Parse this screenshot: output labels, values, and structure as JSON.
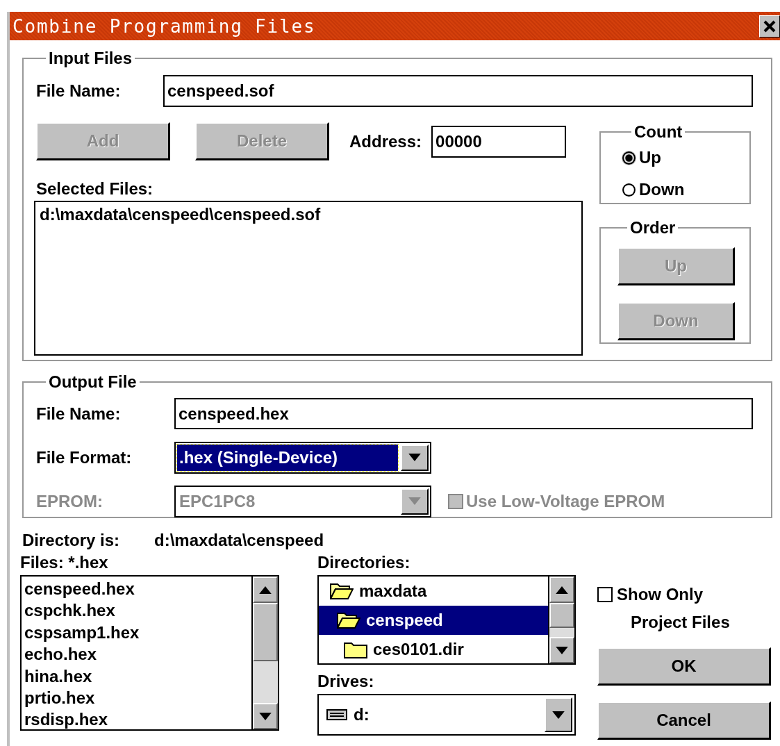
{
  "window": {
    "title": "Combine Programming Files"
  },
  "input_files": {
    "legend": "Input Files",
    "file_name": {
      "label": "File Name:",
      "value": "censpeed.sof"
    },
    "buttons": [
      {
        "label": "Add",
        "disabled": true
      },
      {
        "label": "Delete",
        "disabled": true
      }
    ],
    "address": {
      "label": "Address:",
      "value": "00000"
    },
    "selected_files": {
      "label": "Selected Files:",
      "items": [
        "d:\\maxdata\\censpeed\\censpeed.sof"
      ]
    },
    "count": {
      "legend": "Count",
      "options": [
        {
          "label": "Up",
          "selected": true
        },
        {
          "label": "Down",
          "selected": false
        }
      ]
    },
    "order": {
      "legend": "Order",
      "buttons": [
        {
          "label": "Up",
          "disabled": true
        },
        {
          "label": "Down",
          "disabled": true
        }
      ]
    }
  },
  "output_file": {
    "legend": "Output File",
    "file_name": {
      "label": "File Name:",
      "value": "censpeed.hex"
    },
    "file_format": {
      "label": "File Format:",
      "value": ".hex (Single-Device)",
      "highlighted": true,
      "disabled": false
    },
    "eprom": {
      "label": "EPROM:",
      "value": "EPC1PC8",
      "highlighted": false,
      "disabled": true
    },
    "low_voltage": {
      "label": "Use Low-Voltage EPROM",
      "checked": false,
      "disabled": true
    }
  },
  "directory": {
    "label": "Directory is:",
    "value": "d:\\maxdata\\censpeed"
  },
  "files": {
    "label": "Files: *.hex",
    "items": [
      "censpeed.hex",
      "cspchk.hex",
      "cspsamp1.hex",
      "echo.hex",
      "hina.hex",
      "prtio.hex",
      "rsdisp.hex"
    ]
  },
  "directories": {
    "label": "Directories:",
    "items": [
      {
        "name": "maxdata",
        "kind": "open",
        "selected": false,
        "children": [
          {
            "name": "censpeed",
            "kind": "open",
            "selected": true,
            "children": [
              {
                "name": "ces0101.dir",
                "kind": "closed",
                "selected": false
              }
            ]
          }
        ]
      }
    ]
  },
  "drives": {
    "label": "Drives:",
    "value": "d:"
  },
  "show_only": {
    "label": "Show Only",
    "label_2": "Project Files",
    "checked": false
  },
  "buttons": [
    {
      "label": "OK"
    },
    {
      "label": "Cancel"
    }
  ]
}
